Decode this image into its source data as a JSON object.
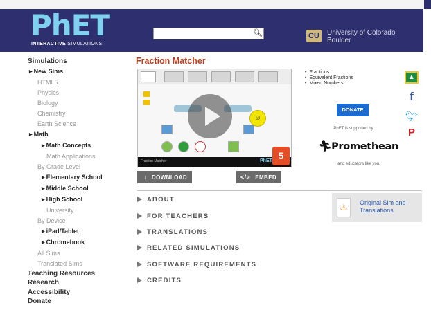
{
  "logo": {
    "wordmark": "PhET",
    "tag_bold": "INTERACTIVE",
    "tag_rest": "SIMULATIONS"
  },
  "search": {
    "placeholder": "",
    "button_icon": "search-icon"
  },
  "university": {
    "mark": "CU",
    "line1": "University of Colorado",
    "line2": "Boulder"
  },
  "sidebar": {
    "items": [
      {
        "label": "Simulations",
        "style": "header"
      },
      {
        "label": "New Sims",
        "style": "bold-arrow"
      },
      {
        "label": "HTML5",
        "style": "gray"
      },
      {
        "label": "Physics",
        "style": "gray"
      },
      {
        "label": "Biology",
        "style": "gray"
      },
      {
        "label": "Chemistry",
        "style": "gray"
      },
      {
        "label": "Earth Science",
        "style": "gray"
      },
      {
        "label": "Math",
        "style": "bold-arrow"
      },
      {
        "label": "Math Concepts",
        "style": "bold-arrow-indent"
      },
      {
        "label": "Math Applications",
        "style": "gray-indent"
      },
      {
        "label": "By Grade Level",
        "style": "gray"
      },
      {
        "label": "Elementary School",
        "style": "bold-arrow-indent"
      },
      {
        "label": "Middle School",
        "style": "bold-arrow-indent"
      },
      {
        "label": "High School",
        "style": "bold-arrow-indent"
      },
      {
        "label": "University",
        "style": "gray-indent"
      },
      {
        "label": "By Device",
        "style": "gray"
      },
      {
        "label": "iPad/Tablet",
        "style": "bold-arrow-indent"
      },
      {
        "label": "Chromebook",
        "style": "bold-arrow-indent"
      },
      {
        "label": "All Sims",
        "style": "gray"
      },
      {
        "label": "Translated Sims",
        "style": "gray"
      },
      {
        "label": "Teaching Resources",
        "style": "header"
      },
      {
        "label": "Research",
        "style": "header"
      },
      {
        "label": "Accessibility",
        "style": "header"
      },
      {
        "label": "Donate",
        "style": "header"
      }
    ]
  },
  "sim": {
    "title": "Fraction Matcher",
    "preview_bar_text": "Fraction Matcher",
    "preview_brand": "PhET",
    "html5_badge": "5",
    "download_label": "DOWNLOAD",
    "embed_label": "EMBED",
    "topics": [
      "Fractions",
      "Equivalent Fractions",
      "Mixed Numbers"
    ]
  },
  "donate": {
    "button": "DONATE",
    "supported_by": "PhET is supported by",
    "sponsor": "Promethean",
    "educators": "and educators like you."
  },
  "accordion": [
    "ABOUT",
    "FOR TEACHERS",
    "TRANSLATIONS",
    "RELATED SIMULATIONS",
    "SOFTWARE REQUIREMENTS",
    "CREDITS"
  ],
  "original_sim": {
    "line1": "Original Sim and",
    "line2": "Translations"
  },
  "colors": {
    "header_bg": "#2d2f6f",
    "title_red": "#bc3d1e",
    "donate_blue": "#1b6bd1",
    "logo_blue": "#7fd1f0"
  }
}
